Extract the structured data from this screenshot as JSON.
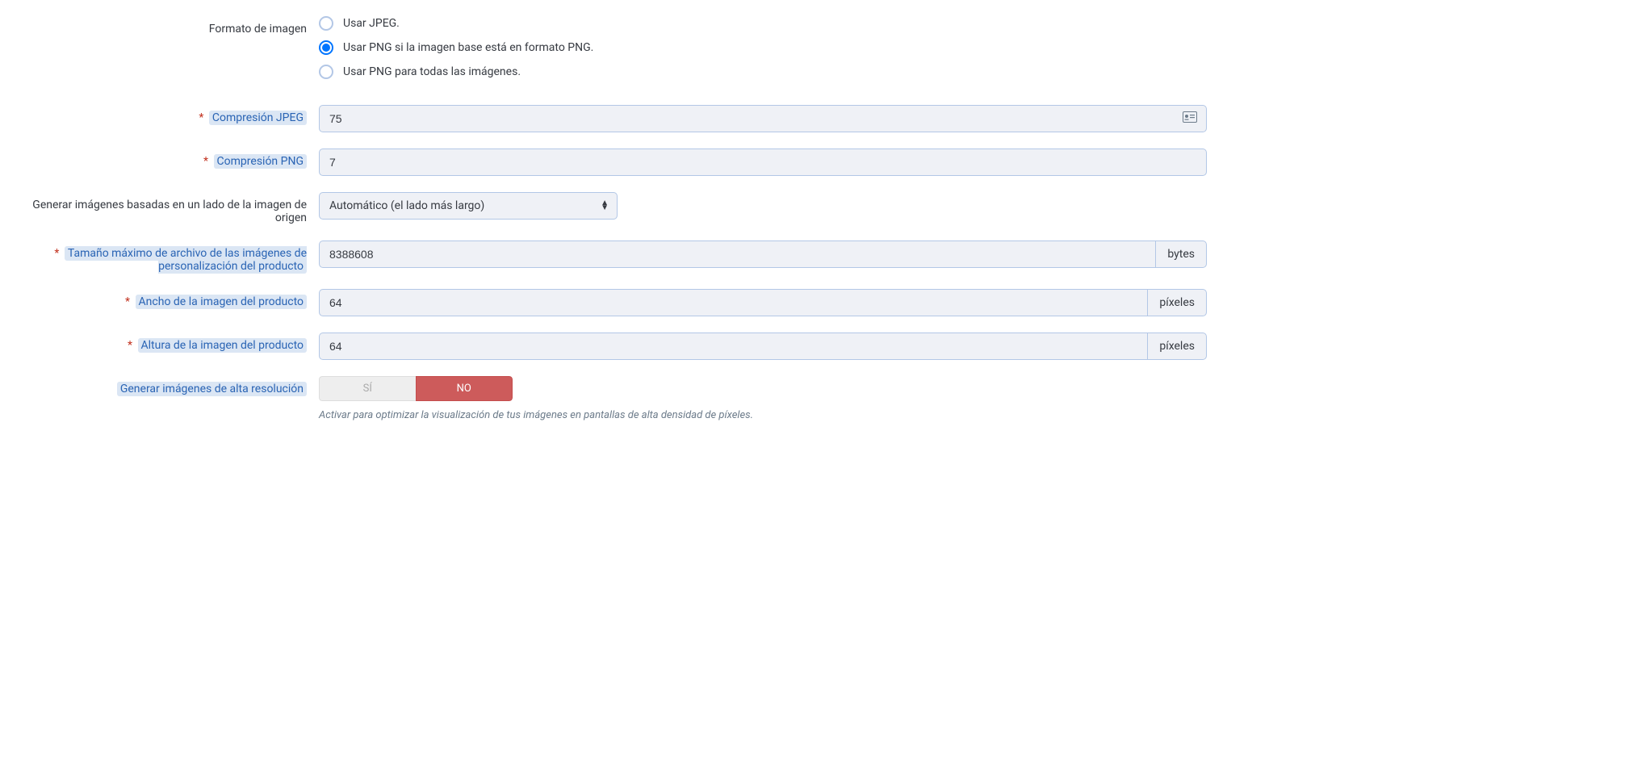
{
  "image_format": {
    "label": "Formato de imagen",
    "options": [
      "Usar JPEG.",
      "Usar PNG si la imagen base está en formato PNG.",
      "Usar PNG para todas las imágenes."
    ],
    "selected_index": 1
  },
  "jpeg_compression": {
    "label": "Compresión JPEG",
    "value": "75"
  },
  "png_compression": {
    "label": "Compresión PNG",
    "value": "7"
  },
  "generate_side": {
    "label": "Generar imágenes basadas en un lado de la imagen de origen",
    "selected": "Automático (el lado más largo)"
  },
  "max_file_size": {
    "label": "Tamaño máximo de archivo de las imágenes de personalización del producto",
    "value": "8388608",
    "unit": "bytes"
  },
  "product_width": {
    "label": "Ancho de la imagen del producto",
    "value": "64",
    "unit": "píxeles"
  },
  "product_height": {
    "label": "Altura de la imagen del producto",
    "value": "64",
    "unit": "píxeles"
  },
  "high_res": {
    "label": "Generar imágenes de alta resolución",
    "yes": "SÍ",
    "no": "NO",
    "help": "Activar para optimizar la visualización de tus imágenes en pantallas de alta densidad de píxeles."
  }
}
